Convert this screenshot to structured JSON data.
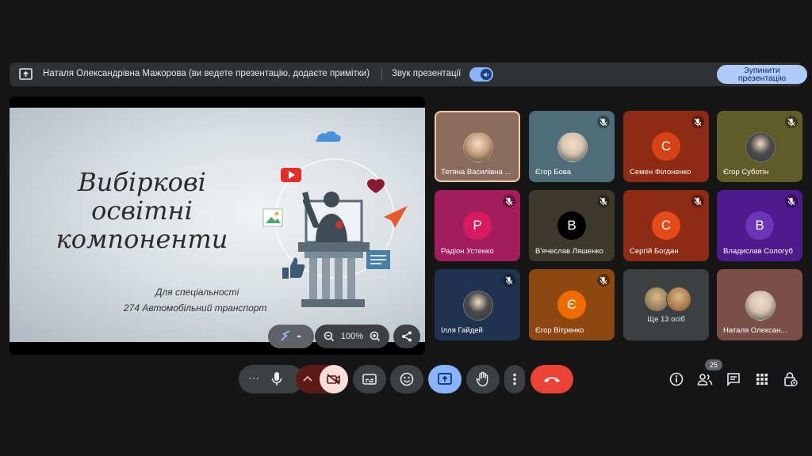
{
  "banner": {
    "presenter_text": "Наталя Олександрівна Мажорова (ви ведете презентацію, додаєте примітки)",
    "sound_label": "Звук презентації",
    "stop_button": "Зупинити презентацію"
  },
  "slide": {
    "title_lines": [
      "Вибіркові",
      "освітні",
      "компоненти"
    ],
    "subtitle_1": "Для спеціальності",
    "subtitle_2": "274 Автомобільний транспорт",
    "zoom": "100%"
  },
  "participants": [
    {
      "name": "Тетяна Василівна ...",
      "avatar": "photo",
      "bg": "#8a6c5c",
      "muted": false,
      "active": true
    },
    {
      "name": "Єгор Бова",
      "avatar": "photo",
      "bg": "#4e6d79",
      "muted": true
    },
    {
      "name": "Семен Філоненко",
      "initial": "С",
      "bg": "#8d2b14",
      "avatar_color": "#d84315",
      "muted": true
    },
    {
      "name": "Єгор Суботін",
      "avatar": "photo",
      "bg": "#5f5c2a",
      "muted": true
    },
    {
      "name": "Радіон Устенко",
      "initial": "Р",
      "bg": "#a11d5c",
      "avatar_color": "#d81b60",
      "muted": true
    },
    {
      "name": "В'ячеслав Ляшенко",
      "initial": "В",
      "bg": "#3d3a2c",
      "avatar_color": "#000000",
      "muted": true
    },
    {
      "name": "Сергій Богдан",
      "initial": "С",
      "bg": "#8d2b14",
      "avatar_color": "#e64a19",
      "muted": true
    },
    {
      "name": "Владислав Сологуб",
      "initial": "В",
      "bg": "#4e1b8c",
      "avatar_color": "#6a35b8",
      "muted": true
    },
    {
      "name": "Ілля Гайдей",
      "avatar": "photo",
      "bg": "#1f3350",
      "muted": true
    },
    {
      "name": "Єгор Вітренко",
      "initial": "Є",
      "bg": "#8d4710",
      "avatar_color": "#ef6c00",
      "muted": true
    },
    {
      "name": "Ще 13 осіб",
      "avatar": "group",
      "bg": "#3c4043",
      "muted": false
    },
    {
      "name": "Наталя Олексан...",
      "avatar": "photo",
      "bg": "#7a4f47",
      "muted": false
    }
  ],
  "toolbar": {
    "people_count": "25"
  },
  "colors": {
    "accent": "#8ab4f8",
    "end_call": "#ea4335",
    "camera_off": "#f9dedc"
  }
}
